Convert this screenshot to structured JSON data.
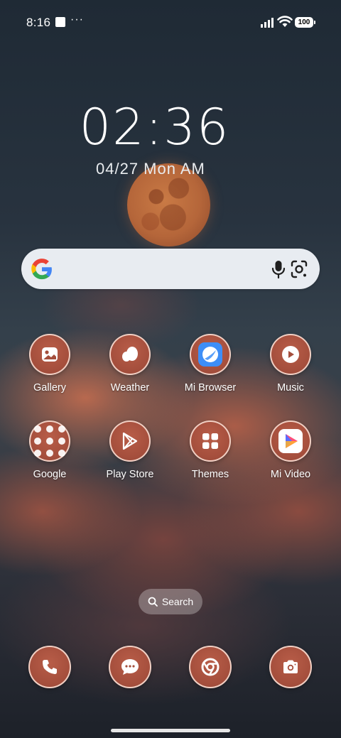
{
  "status_bar": {
    "time": "8:16",
    "overflow": "···",
    "battery": "100",
    "icons": [
      "notification-square-icon",
      "signal-icon",
      "wifi-icon",
      "battery-icon"
    ]
  },
  "clock": {
    "time": "02:36",
    "date": "04/27 Mon AM"
  },
  "search_widget": {
    "icons": [
      "google-logo-icon",
      "microphone-icon",
      "lens-camera-icon"
    ]
  },
  "apps": [
    {
      "label": "Gallery",
      "icon": "gallery-icon"
    },
    {
      "label": "Weather",
      "icon": "weather-icon"
    },
    {
      "label": "Mi Browser",
      "icon": "browser-icon"
    },
    {
      "label": "Music",
      "icon": "music-icon"
    },
    {
      "label": "Google",
      "icon": "folder-icon"
    },
    {
      "label": "Play Store",
      "icon": "play-store-icon"
    },
    {
      "label": "Themes",
      "icon": "themes-icon"
    },
    {
      "label": "Mi Video",
      "icon": "video-icon"
    }
  ],
  "app_search": {
    "label": "Search"
  },
  "dock": [
    {
      "icon": "phone-icon"
    },
    {
      "icon": "messages-icon"
    },
    {
      "icon": "chrome-icon"
    },
    {
      "icon": "camera-icon"
    }
  ],
  "colors": {
    "icon_fill": "#a44e3c",
    "icon_ring": "#ffe6dc",
    "search_bar": "#e8ecf1"
  }
}
